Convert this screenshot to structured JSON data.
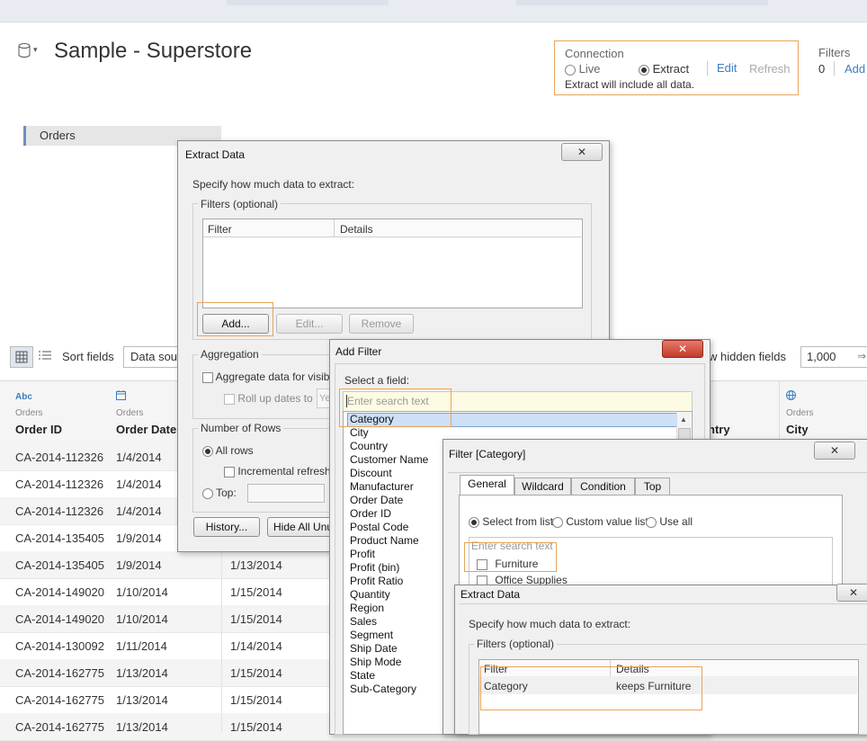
{
  "datasource": {
    "title": "Sample - Superstore"
  },
  "connection": {
    "label": "Connection",
    "live": "Live",
    "extract": "Extract",
    "edit": "Edit",
    "refresh": "Refresh",
    "note": "Extract will include all data."
  },
  "filters": {
    "label": "Filters",
    "count": "0",
    "add": "Add"
  },
  "left_pane": {
    "table": "Orders"
  },
  "toolbar": {
    "sort_label": "Sort fields",
    "sort_value": "Data sou",
    "show_hidden": "w hidden fields",
    "rows_value": "1,000"
  },
  "grid": {
    "columns": [
      {
        "type": "Abc",
        "source": "Orders",
        "name": "Order ID"
      },
      {
        "type": "date",
        "source": "Orders",
        "name": "Order Date"
      },
      {
        "type": "",
        "source": "",
        "name": "ntry"
      },
      {
        "type": "geo",
        "source": "Orders",
        "name": "City"
      }
    ],
    "rows": [
      {
        "order_id": "CA-2014-112326",
        "order_date": "1/4/2014",
        "ship_date": ""
      },
      {
        "order_id": "CA-2014-112326",
        "order_date": "1/4/2014",
        "ship_date": ""
      },
      {
        "order_id": "CA-2014-112326",
        "order_date": "1/4/2014",
        "ship_date": ""
      },
      {
        "order_id": "CA-2014-135405",
        "order_date": "1/9/2014",
        "ship_date": ""
      },
      {
        "order_id": "CA-2014-135405",
        "order_date": "1/9/2014",
        "ship_date": "1/13/2014"
      },
      {
        "order_id": "CA-2014-149020",
        "order_date": "1/10/2014",
        "ship_date": "1/15/2014"
      },
      {
        "order_id": "CA-2014-149020",
        "order_date": "1/10/2014",
        "ship_date": "1/15/2014"
      },
      {
        "order_id": "CA-2014-130092",
        "order_date": "1/11/2014",
        "ship_date": "1/14/2014"
      },
      {
        "order_id": "CA-2014-162775",
        "order_date": "1/13/2014",
        "ship_date": "1/15/2014"
      },
      {
        "order_id": "CA-2014-162775",
        "order_date": "1/13/2014",
        "ship_date": "1/15/2014"
      },
      {
        "order_id": "CA-2014-162775",
        "order_date": "1/13/2014",
        "ship_date": "1/15/2014"
      }
    ]
  },
  "extract_dialog_1": {
    "title": "Extract Data",
    "close": "✕",
    "prompt": "Specify how much data to extract:",
    "filters_label": "Filters (optional)",
    "col_filter": "Filter",
    "col_details": "Details",
    "add": "Add...",
    "edit": "Edit...",
    "remove": "Remove",
    "aggregation_label": "Aggregation",
    "aggregate": "Aggregate data for visible",
    "rollup": "Roll up dates to",
    "rollup_value": "Ye",
    "rows_label": "Number of Rows",
    "all_rows": "All rows",
    "incremental": "Incremental refresh",
    "top": "Top:",
    "history": "History...",
    "hide_unused": "Hide All Unus"
  },
  "add_filter_dialog": {
    "title": "Add Filter",
    "close": "✕",
    "select_label": "Select a field:",
    "search_placeholder": "Enter search text",
    "fields": [
      "Category",
      "City",
      "Country",
      "Customer Name",
      "Discount",
      "Manufacturer",
      "Order Date",
      "Order ID",
      "Postal Code",
      "Product Name",
      "Profit",
      "Profit (bin)",
      "Profit Ratio",
      "Quantity",
      "Region",
      "Sales",
      "Segment",
      "Ship Date",
      "Ship Mode",
      "State",
      "Sub-Category"
    ]
  },
  "filter_category_dialog": {
    "title": "Filter [Category]",
    "close": "✕",
    "tabs": [
      "General",
      "Wildcard",
      "Condition",
      "Top"
    ],
    "select_from_list": "Select from list",
    "custom_value_list": "Custom value list",
    "use_all": "Use all",
    "search_placeholder": "Enter search text",
    "items": [
      "Furniture",
      "Office Supplies"
    ]
  },
  "extract_dialog_2": {
    "title": "Extract Data",
    "close": "✕",
    "prompt": "Specify how much data to extract:",
    "filters_label": "Filters (optional)",
    "col_filter": "Filter",
    "col_details": "Details",
    "row_filter": "Category",
    "row_details": "keeps Furniture"
  },
  "colors": {
    "highlight": "#e8a35a",
    "link": "#3a7fc1",
    "selection": "#cde0f7"
  }
}
